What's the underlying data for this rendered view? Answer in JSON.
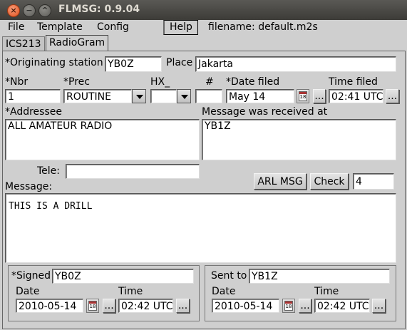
{
  "window": {
    "title": "FLMSG: 0.9.04"
  },
  "menu": {
    "file": "File",
    "template": "Template",
    "config": "Config",
    "help": "Help",
    "filename": "filename: default.m2s"
  },
  "tabs": {
    "ics213": "ICS213",
    "radiogram": "RadioGram"
  },
  "form": {
    "orig_station_label": "*Originating station",
    "orig_station": "YB0Z",
    "place_label": "Place",
    "place": "Jakarta",
    "nbr_label": "*Nbr",
    "nbr": "1",
    "prec_label": "*Prec",
    "prec": "ROUTINE",
    "hx_label": "HX_",
    "hx": "",
    "check_label": "#",
    "check_value": "",
    "date_filed_label": "*Date filed",
    "date_filed": "May 14",
    "ellipsis": "...",
    "time_filed_label": "Time filed",
    "time_filed": "02:41 UTC",
    "addressee_label": "*Addressee",
    "addressee": "ALL AMATEUR RADIO",
    "received_label": "Message was received at",
    "received": "YB1Z",
    "tele_label": "Tele:",
    "tele": "",
    "message_label": "Message:",
    "message": "THIS IS A DRILL",
    "arl_button": "ARL MSG",
    "check_button": "Check",
    "count": "4",
    "cal_text": "18"
  },
  "signed": {
    "label": "*Signed",
    "value": "YB0Z",
    "date_label": "Date",
    "date": "2010-05-14",
    "time_label": "Time",
    "time": "02:42 UTC"
  },
  "sent": {
    "label": "Sent to",
    "value": "YB1Z",
    "date_label": "Date",
    "date": "2010-05-14",
    "time_label": "Time",
    "time": "02:42 UTC"
  }
}
